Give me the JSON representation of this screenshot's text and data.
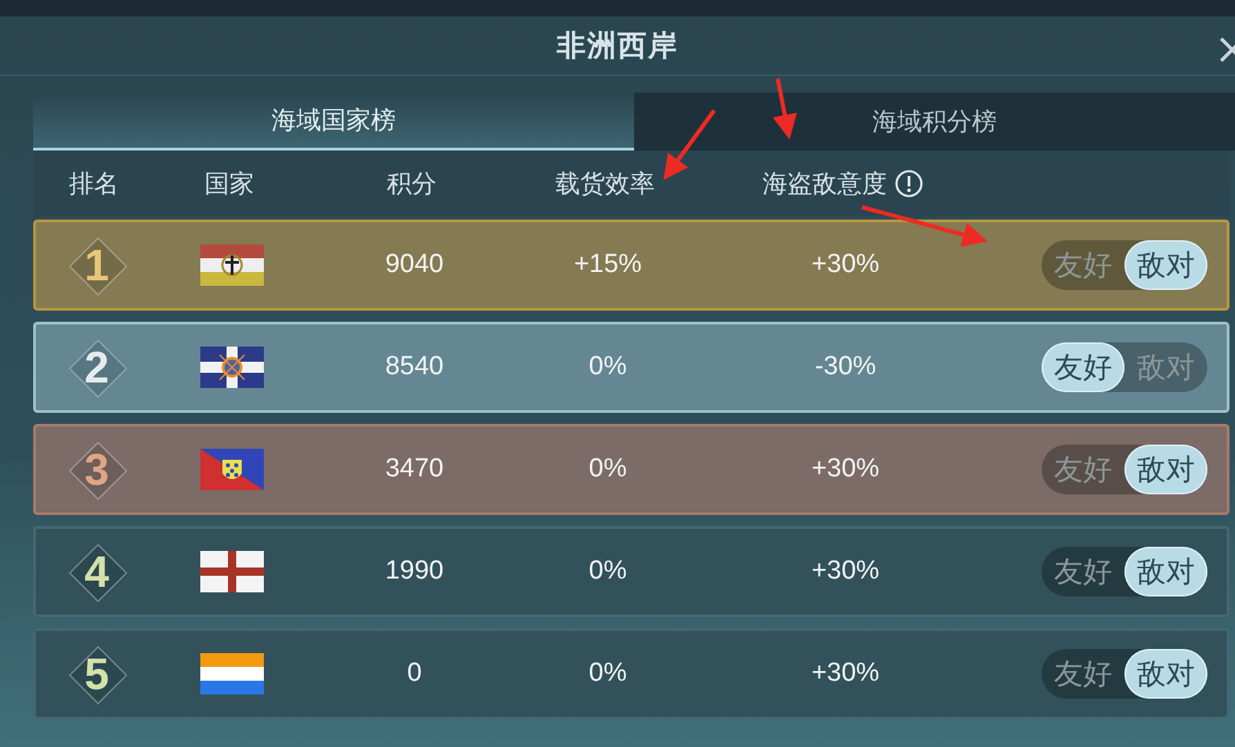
{
  "window": {
    "title": "非洲西岸"
  },
  "tabs": [
    {
      "label": "海域国家榜",
      "selected": true
    },
    {
      "label": "海域积分榜",
      "selected": false
    }
  ],
  "table": {
    "columns": [
      "排名",
      "国家",
      "积分",
      "载货效率",
      "海盗敌意度"
    ],
    "rows": [
      {
        "kind": "gold",
        "rank": "1",
        "score": "9040",
        "cargo": "+15%",
        "hostility": "+30%",
        "stance": [
          {
            "label": "友好",
            "selected": false
          },
          {
            "label": "敌对",
            "selected": true
          }
        ]
      },
      {
        "kind": "silver",
        "rank": "2",
        "score": "8540",
        "cargo": "0%",
        "hostility": "-30%",
        "stance": [
          {
            "label": "友好",
            "selected": true
          },
          {
            "label": "敌对",
            "selected": false
          }
        ]
      },
      {
        "kind": "bronze",
        "rank": "3",
        "score": "3470",
        "cargo": "0%",
        "hostility": "+30%",
        "stance": [
          {
            "label": "友好",
            "selected": false
          },
          {
            "label": "敌对",
            "selected": true
          }
        ]
      },
      {
        "kind": "plain",
        "rank": "4",
        "score": "1990",
        "cargo": "0%",
        "hostility": "+30%",
        "stance": [
          {
            "label": "友好",
            "selected": false
          },
          {
            "label": "敌对",
            "selected": true
          }
        ]
      },
      {
        "kind": "plain",
        "rank": "5",
        "score": "0",
        "cargo": "0%",
        "hostility": "+30%",
        "stance": [
          {
            "label": "友好",
            "selected": false
          },
          {
            "label": "敌对",
            "selected": true
          }
        ]
      }
    ]
  }
}
